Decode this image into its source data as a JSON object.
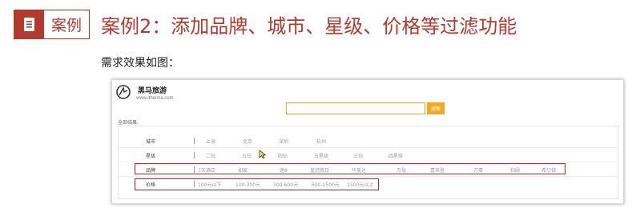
{
  "header": {
    "badge_label": "案例",
    "title": "案例2：添加品牌、城市、星级、价格等过滤功能",
    "subtitle": "需求效果如图："
  },
  "colors": {
    "accent": "#b33a2c",
    "highlight": "#c0202a",
    "search_orange": "#f5a623"
  },
  "screenshot": {
    "brand_name": "黑马旅游",
    "brand_url": "www.itheima.com",
    "search_placeholder": "",
    "search_button": "搜索",
    "all_results": "全部结果:",
    "filters": [
      {
        "label": "城市",
        "options": [
          "上海",
          "北京",
          "深圳",
          "杭州"
        ]
      },
      {
        "label": "星级",
        "options": [
          "二钻",
          "五钻",
          "四钻",
          "五星级",
          "三钻",
          "四星级"
        ]
      },
      {
        "label": "品牌",
        "options": [
          "7天酒店",
          "如家",
          "速8",
          "皇冠假日",
          "华美达",
          "万怡",
          "喜来登",
          "万豪",
          "和颐",
          "希尔顿"
        ]
      },
      {
        "label": "价格",
        "options": [
          "100元以下",
          "100-300元",
          "300-600元",
          "600-1500元",
          "1500元以上"
        ]
      }
    ]
  }
}
